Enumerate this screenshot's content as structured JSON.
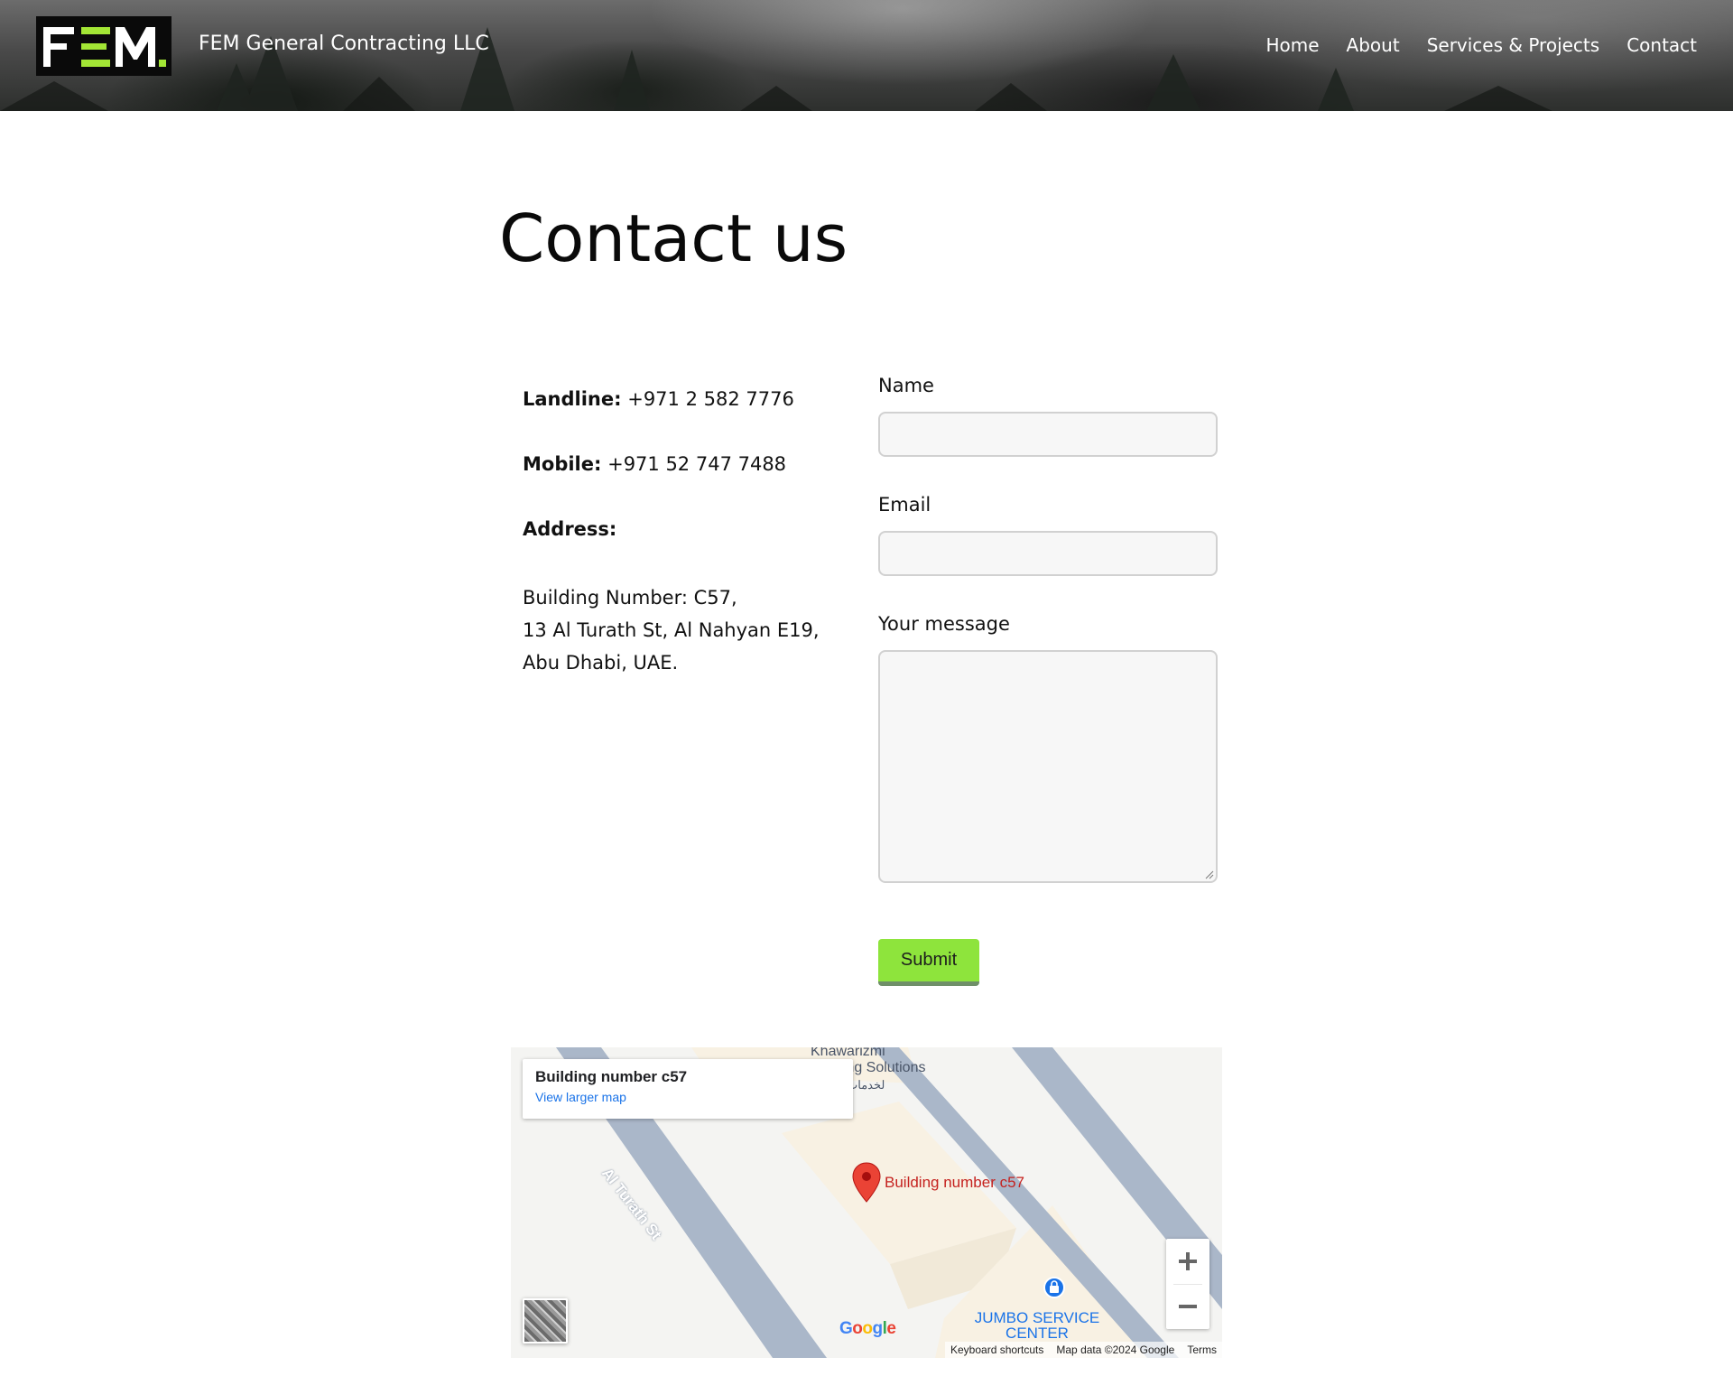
{
  "header": {
    "brand_name": "FEM General Contracting LLC",
    "logo_text": "FEM",
    "nav": [
      {
        "label": "Home"
      },
      {
        "label": "About"
      },
      {
        "label": "Services & Projects"
      },
      {
        "label": "Contact"
      }
    ]
  },
  "page": {
    "title": "Contact us"
  },
  "contact_info": {
    "landline_label": "Landline:",
    "landline_value": "+971 2 582 7776",
    "mobile_label": "Mobile:",
    "mobile_value": "+971 52 747 7488",
    "address_label": "Address:",
    "address_lines": [
      "Building Number: C57,",
      "13 Al Turath St, Al Nahyan E19,",
      "Abu Dhabi, UAE."
    ]
  },
  "form": {
    "name_label": "Name",
    "name_value": "",
    "email_label": "Email",
    "email_value": "",
    "message_label": "Your message",
    "message_value": "",
    "submit_label": "Submit"
  },
  "map": {
    "card_title": "Building number c57",
    "card_link": "View larger map",
    "pin_label": "Building number c57",
    "street_label": "Al Turath St",
    "poi_top_1": "Khawarizmi",
    "poi_top_2": "Training Solutions",
    "poi_top_arabic": "لخدمات",
    "poi_bottom_1": "JUMBO SERVICE",
    "poi_bottom_2": "CENTER",
    "google_logo": "Google",
    "footer_shortcuts": "Keyboard shortcuts",
    "footer_data": "Map data ©2024 Google",
    "footer_terms": "Terms",
    "zoom_in": "+",
    "zoom_out": "−"
  },
  "colors": {
    "accent_green": "#8ee43c",
    "logo_green": "#a3e635",
    "link_blue": "#1a73e8",
    "pin_red": "#ea4335",
    "road_blue": "#aab7c9",
    "poi_blue": "#1a73e8"
  }
}
